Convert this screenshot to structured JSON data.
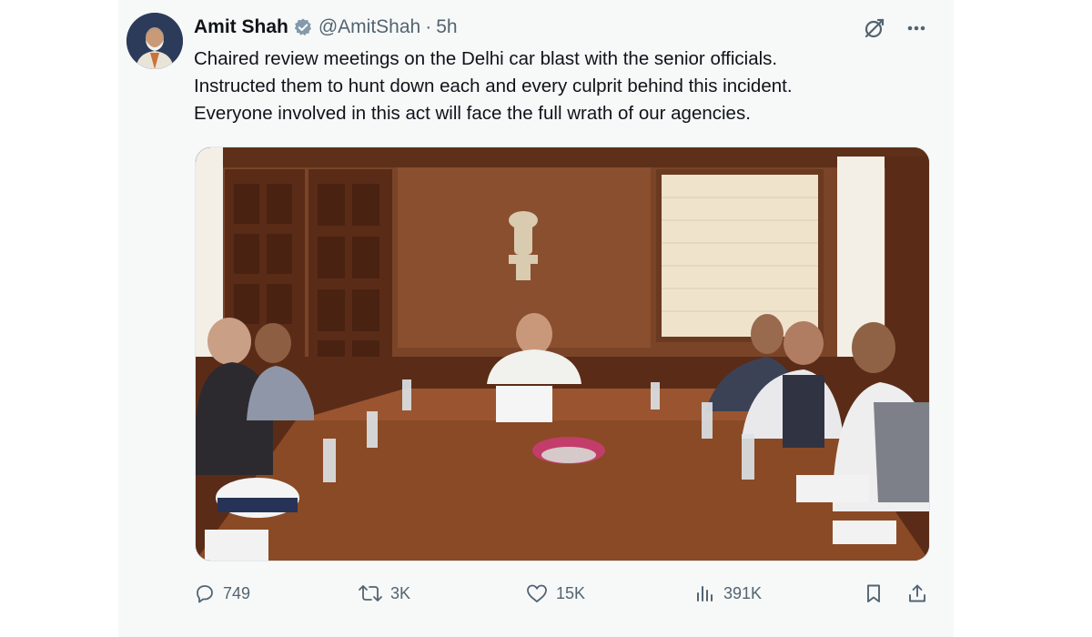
{
  "tweet": {
    "author_name": "Amit Shah",
    "handle": "@AmitShah",
    "separator": "·",
    "time": "5h",
    "text_lines": [
      "Chaired review meetings on the Delhi car blast with the senior officials.",
      "Instructed them to hunt down each and every culprit behind this incident.",
      "Everyone involved in this act will face the full wrath of our agencies."
    ],
    "photo_alt": "photo-meeting-room",
    "verified_color": "#829aab"
  },
  "actions": {
    "replies": "749",
    "reposts": "3K",
    "likes": "15K",
    "views": "391K"
  },
  "icons": [
    "verified-badge-icon",
    "grok-icon",
    "more-icon",
    "reply-icon",
    "repost-icon",
    "like-icon",
    "views-icon",
    "bookmark-icon",
    "share-icon"
  ],
  "colors": {
    "text": "#0f1419",
    "secondary": "#536471",
    "card_bg": "#f7f9f9"
  }
}
